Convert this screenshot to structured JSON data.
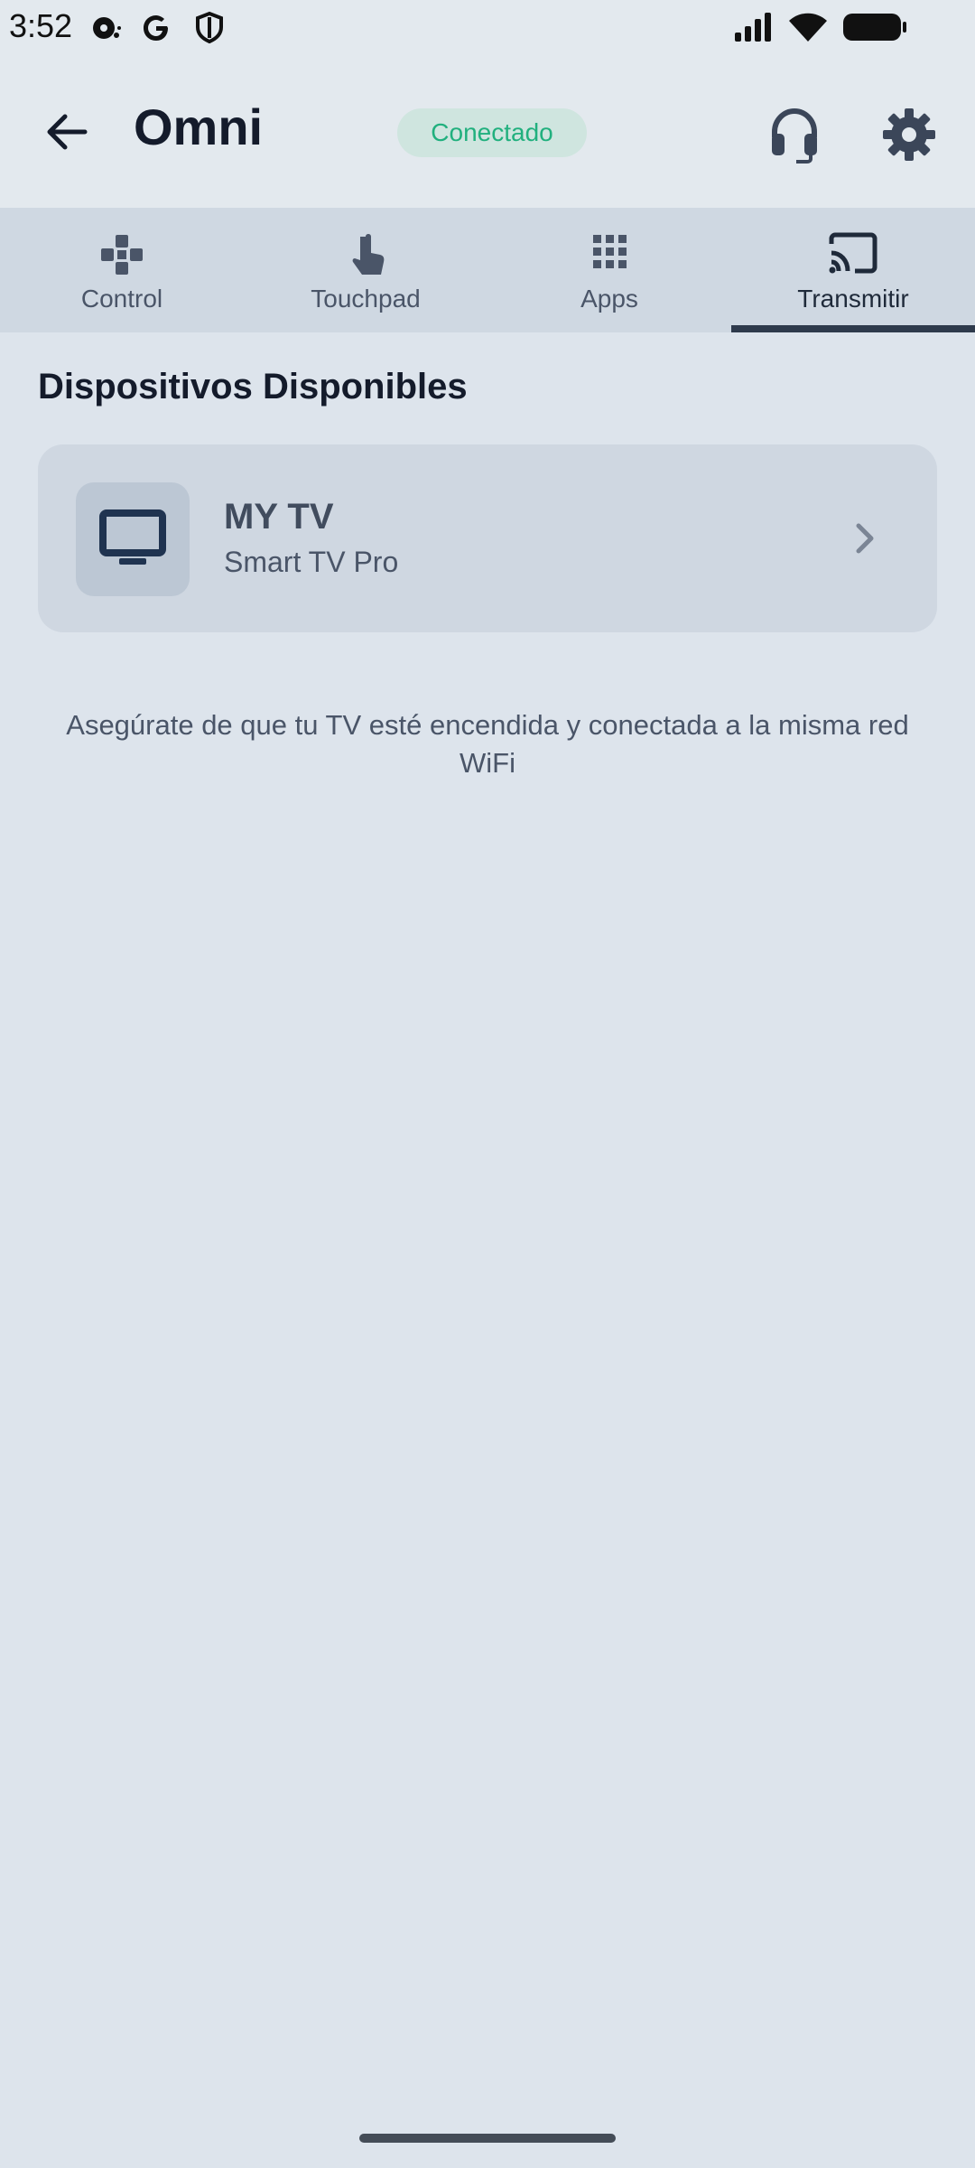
{
  "status_bar": {
    "time": "3:52",
    "left_icons": [
      "media-icon",
      "google-icon",
      "shield-icon"
    ],
    "right_icons": [
      "signal-icon",
      "wifi-icon",
      "battery-icon"
    ]
  },
  "app_bar": {
    "back_icon": "arrow-back-icon",
    "title": "Omni",
    "status_badge": "Conectado",
    "support_icon": "headset-icon",
    "settings_icon": "gear-icon"
  },
  "tabs": [
    {
      "label": "Control",
      "icon": "gamepad-icon",
      "active": false
    },
    {
      "label": "Touchpad",
      "icon": "touch-icon",
      "active": false
    },
    {
      "label": "Apps",
      "icon": "grid-icon",
      "active": false
    },
    {
      "label": "Transmitir",
      "icon": "cast-icon",
      "active": true
    }
  ],
  "main": {
    "section_title": "Dispositivos Disponibles",
    "devices": [
      {
        "name": "MY TV",
        "model": "Smart TV Pro",
        "icon": "tv-icon"
      }
    ],
    "hint": "Asegúrate de que tu TV esté encendida y conectada a la misma red WiFi"
  },
  "colors": {
    "background": "#dde4ec",
    "app_bar": "#e3e9ee",
    "tab_bar": "#cfd8e2",
    "card": "#cfd7e1",
    "accent_green": "#21b07e",
    "badge_bg": "#cfe5df",
    "indicator": "#2e3a4c"
  }
}
